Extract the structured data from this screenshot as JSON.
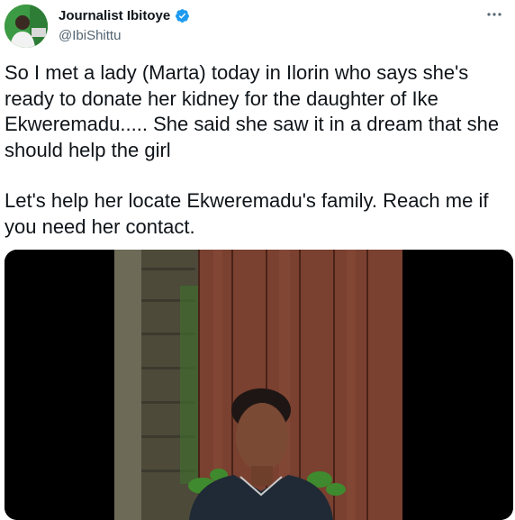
{
  "author": {
    "name": "Journalist Ibitoye",
    "handle": "@IbiShittu",
    "verified": true
  },
  "tweet": {
    "paragraph1": "So I met a lady (Marta) today in Ilorin who says she's ready to donate her kidney for the daughter of Ike Ekweremadu..... She said she saw it in a dream that she should help the girl",
    "paragraph2": "Let's help her locate Ekweremadu's family. Reach me if you need her contact."
  },
  "icons": {
    "more": "more-options-icon",
    "verified": "verified-badge-icon"
  },
  "colors": {
    "accent": "#1d9bf0",
    "secondary_text": "#536471",
    "text": "#0f1419"
  }
}
